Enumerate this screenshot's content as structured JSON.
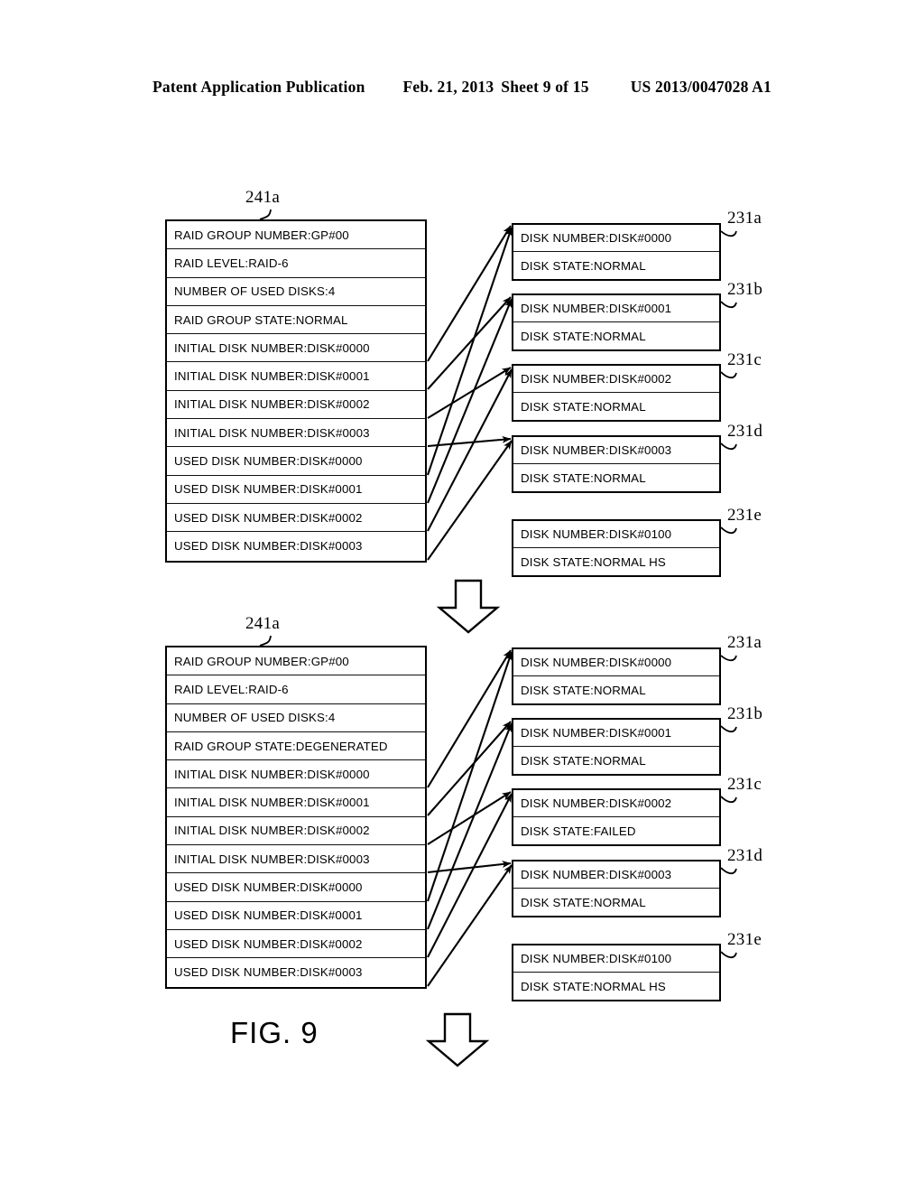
{
  "header": {
    "publication": "Patent Application Publication",
    "date": "Feb. 21, 2013",
    "sheet": "Sheet 9 of 15",
    "number": "US 2013/0047028 A1"
  },
  "figure": {
    "caption": "FIG. 9"
  },
  "panels": [
    {
      "id": "top",
      "raid_table": {
        "ref_label": "241a",
        "rows": [
          "RAID GROUP NUMBER:GP#00",
          "RAID LEVEL:RAID-6",
          "NUMBER OF USED DISKS:4",
          "RAID GROUP STATE:NORMAL",
          "INITIAL DISK NUMBER:DISK#0000",
          "INITIAL DISK NUMBER:DISK#0001",
          "INITIAL DISK NUMBER:DISK#0002",
          "INITIAL DISK NUMBER:DISK#0003",
          "USED DISK NUMBER:DISK#0000",
          "USED DISK NUMBER:DISK#0001",
          "USED DISK NUMBER:DISK#0002",
          "USED DISK NUMBER:DISK#0003"
        ]
      },
      "disks": [
        {
          "ref_label": "231a",
          "number": "DISK NUMBER:DISK#0000",
          "state": "DISK STATE:NORMAL"
        },
        {
          "ref_label": "231b",
          "number": "DISK NUMBER:DISK#0001",
          "state": "DISK STATE:NORMAL"
        },
        {
          "ref_label": "231c",
          "number": "DISK NUMBER:DISK#0002",
          "state": "DISK STATE:NORMAL"
        },
        {
          "ref_label": "231d",
          "number": "DISK NUMBER:DISK#0003",
          "state": "DISK STATE:NORMAL"
        },
        {
          "ref_label": "231e",
          "number": "DISK NUMBER:DISK#0100",
          "state": "DISK STATE:NORMAL HS"
        }
      ]
    },
    {
      "id": "bottom",
      "raid_table": {
        "ref_label": "241a",
        "rows": [
          "RAID GROUP NUMBER:GP#00",
          "RAID LEVEL:RAID-6",
          "NUMBER OF USED DISKS:4",
          "RAID GROUP STATE:DEGENERATED",
          "INITIAL DISK NUMBER:DISK#0000",
          "INITIAL DISK NUMBER:DISK#0001",
          "INITIAL DISK NUMBER:DISK#0002",
          "INITIAL DISK NUMBER:DISK#0003",
          "USED DISK NUMBER:DISK#0000",
          "USED DISK NUMBER:DISK#0001",
          "USED DISK NUMBER:DISK#0002",
          "USED DISK NUMBER:DISK#0003"
        ]
      },
      "disks": [
        {
          "ref_label": "231a",
          "number": "DISK NUMBER:DISK#0000",
          "state": "DISK STATE:NORMAL"
        },
        {
          "ref_label": "231b",
          "number": "DISK NUMBER:DISK#0001",
          "state": "DISK STATE:NORMAL"
        },
        {
          "ref_label": "231c",
          "number": "DISK NUMBER:DISK#0002",
          "state": "DISK STATE:FAILED"
        },
        {
          "ref_label": "231d",
          "number": "DISK NUMBER:DISK#0003",
          "state": "DISK STATE:NORMAL"
        },
        {
          "ref_label": "231e",
          "number": "DISK NUMBER:DISK#0100",
          "state": "DISK STATE:NORMAL HS"
        }
      ]
    }
  ],
  "flow_arrows": [
    {
      "name": "flow-arrow-middle"
    },
    {
      "name": "flow-arrow-bottom"
    }
  ]
}
